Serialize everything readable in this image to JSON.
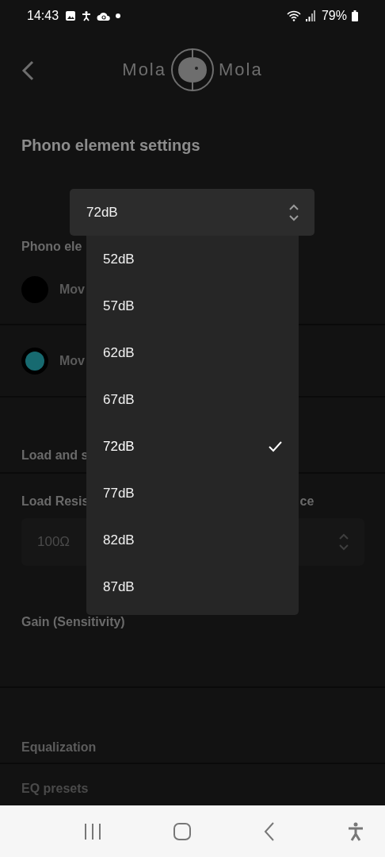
{
  "status_bar": {
    "time": "14:43",
    "battery": "79%"
  },
  "header": {
    "logo_left": "Mola",
    "logo_right": "Mola"
  },
  "title": "Phono element settings",
  "phono_section": {
    "label": "Phono ele",
    "options": [
      {
        "label": "Mov",
        "selected": false
      },
      {
        "label": "Mov",
        "selected": true
      }
    ]
  },
  "load_section": {
    "label": "Load and s",
    "fields": [
      {
        "label": "Load Resis",
        "value": "100Ω"
      },
      {
        "label": "ce"
      }
    ],
    "gain_label": "Gain (Sensitivity)"
  },
  "eq_section": {
    "label": "Equalization",
    "presets_label": "EQ presets"
  },
  "dropdown": {
    "value": "72dB",
    "options": [
      {
        "label": "52dB",
        "selected": false
      },
      {
        "label": "57dB",
        "selected": false
      },
      {
        "label": "62dB",
        "selected": false
      },
      {
        "label": "67dB",
        "selected": false
      },
      {
        "label": "72dB",
        "selected": true
      },
      {
        "label": "77dB",
        "selected": false
      },
      {
        "label": "82dB",
        "selected": false
      },
      {
        "label": "87dB",
        "selected": false
      }
    ]
  }
}
